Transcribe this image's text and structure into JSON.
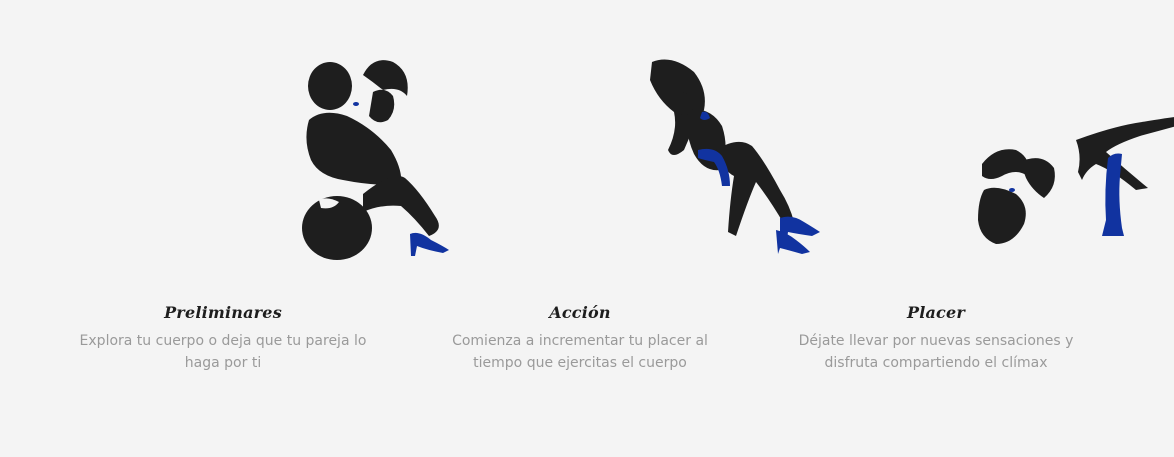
{
  "colors": {
    "background": "#f4f4f4",
    "silhouette": "#1e1e1e",
    "accent_blue": "#1133a0"
  },
  "features": [
    {
      "icon": "couple-embrace-icon",
      "title": "Preliminares",
      "desc_lines": [
        "Explora tu cuerpo o deja que tu pareja lo",
        "haga por ti"
      ]
    },
    {
      "icon": "woman-reclining-icon",
      "title": "Acción",
      "desc_lines": [
        "Comienza a incrementar tu placer al",
        "tiempo que ejercitas el cuerpo"
      ]
    },
    {
      "icon": "couple-legs-up-icon",
      "title": "Placer",
      "desc_lines": [
        "Déjate llevar por nuevas sensaciones y",
        "disfruta compartiendo el clímax"
      ]
    }
  ]
}
